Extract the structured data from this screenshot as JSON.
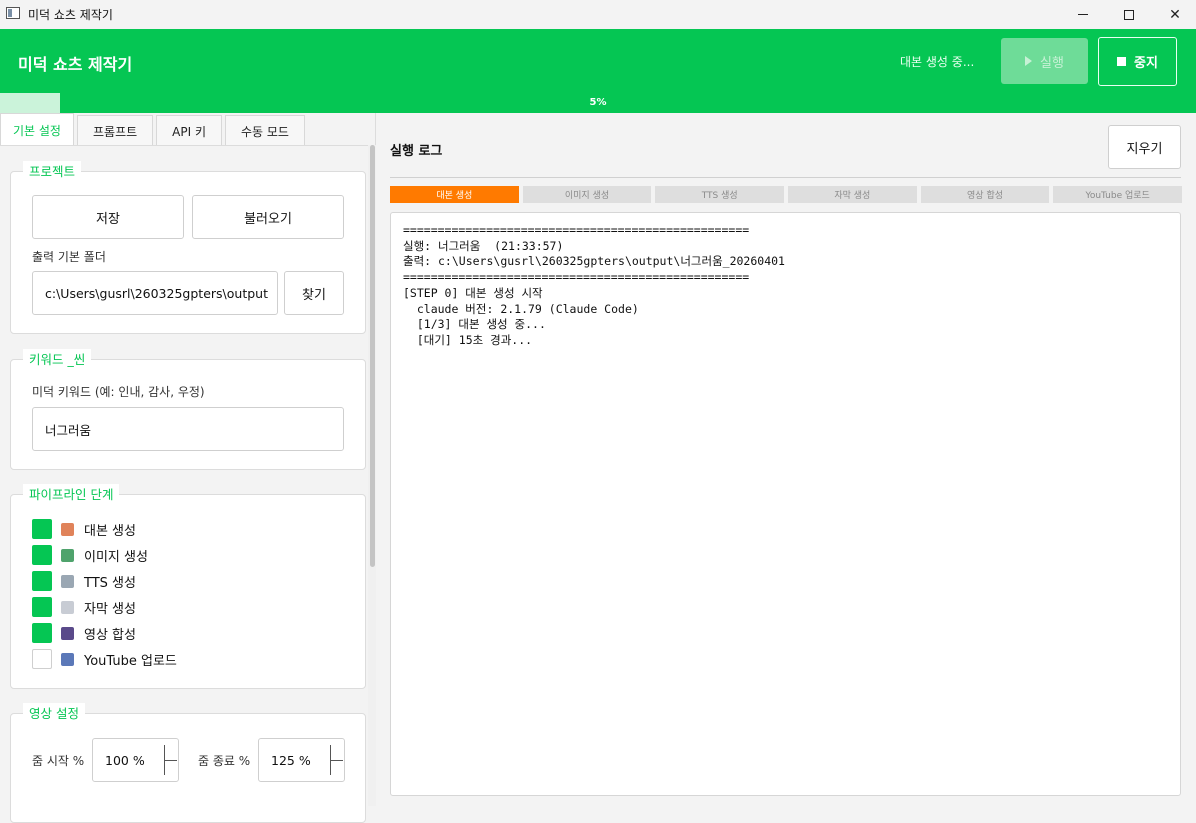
{
  "window": {
    "title": "미덕 쇼츠 제작기"
  },
  "header": {
    "title": "미덕 쇼츠 제작기",
    "status": "대본 생성 중...",
    "run_label": "실행",
    "stop_label": "중지"
  },
  "progress": {
    "value": 0.05,
    "label": "5%"
  },
  "tabs": [
    {
      "label": "기본 설정",
      "active": true
    },
    {
      "label": "프롬프트"
    },
    {
      "label": "API 키"
    },
    {
      "label": "수동 모드"
    }
  ],
  "project": {
    "title": "프로젝트",
    "save_label": "저장",
    "load_label": "불러오기",
    "output_label": "출력 기본 폴더",
    "output_value": "c:\\Users\\gusrl\\260325gpters\\output",
    "browse_label": "찾기"
  },
  "keyword": {
    "title": "키워드 _씬",
    "field_label": "미덕 키워드 (예: 인내, 감사, 우정)",
    "value": "너그러움"
  },
  "pipeline": {
    "title": "파이프라인 단계",
    "items": [
      {
        "label": "대본 생성",
        "checked": true,
        "icon": "script-icon",
        "color": "#e0835a"
      },
      {
        "label": "이미지 생성",
        "checked": true,
        "icon": "image-icon",
        "color": "#4fa36c"
      },
      {
        "label": "TTS 생성",
        "checked": true,
        "icon": "speaker-icon",
        "color": "#9aa7b3"
      },
      {
        "label": "자막 생성",
        "checked": true,
        "icon": "document-icon",
        "color": "#c8ccd4"
      },
      {
        "label": "영상 합성",
        "checked": true,
        "icon": "clapper-icon",
        "color": "#5a4a8a"
      },
      {
        "label": "YouTube 업로드",
        "checked": false,
        "icon": "upload-icon",
        "color": "#5b78b8"
      }
    ]
  },
  "video": {
    "title": "영상 설정",
    "zoom_start_label": "줌 시작 %",
    "zoom_start_value": "100 %",
    "zoom_end_label": "줌 종료 %",
    "zoom_end_value": "125 %"
  },
  "log": {
    "title": "실행 로그",
    "clear_label": "지우기",
    "steps": [
      {
        "label": "대본 생성",
        "active": true
      },
      {
        "label": "이미지 생성"
      },
      {
        "label": "TTS 생성"
      },
      {
        "label": "자막 생성"
      },
      {
        "label": "영상 합성"
      },
      {
        "label": "YouTube 업로드"
      }
    ],
    "text": "==================================================\n실행: 너그러움  (21:33:57)\n출력: c:\\Users\\gusrl\\260325gpters\\output\\너그러움_20260401\n==================================================\n[STEP 0] 대본 생성 시작\n  claude 버전: 2.1.79 (Claude Code)\n  [1/3] 대본 생성 중...\n  [대기] 15초 경과..."
  },
  "colors": {
    "accent": "#05c653",
    "active_step": "#ff7a00"
  }
}
